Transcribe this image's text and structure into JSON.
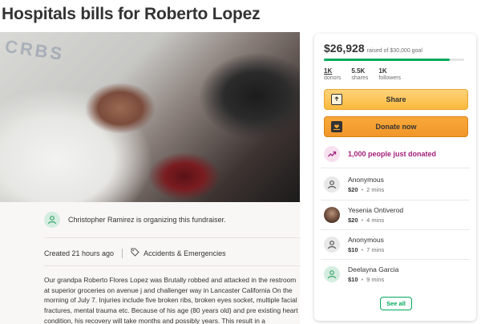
{
  "campaign": {
    "title": "Hospitals bills for Roberto Lopez",
    "photo_text": "CRBS"
  },
  "organizer": {
    "text": "Christopher Ramirez is organizing this fundraiser."
  },
  "meta": {
    "created": "Created 21 hours ago",
    "category": "Accidents & Emergencies"
  },
  "story": "Our grandpa Roberto Flores Lopez was Brutally robbed and attacked in the restroom at superior groceries on avenue j and challenger way in Lancaster California On the morning of July 7. Injuries include five broken ribs, broken eyes socket, multiple facial fractures, mental trauma etc. Because of his age (80 years old) and pre existing heart condition, his recovery will take months and possibly years. This result in a",
  "sidebar": {
    "raised": "$26,928",
    "goal_text": "raised of $30,000 goal",
    "progress_fraction": 0.8976,
    "stats": [
      {
        "value": "1K",
        "label": "donors"
      },
      {
        "value": "5.5K",
        "label": "shares"
      },
      {
        "value": "1K",
        "label": "followers"
      }
    ],
    "share_label": "Share",
    "donate_label": "Donate now",
    "trending_text": "1,000 people just donated",
    "donations": [
      {
        "name": "Anonymous",
        "amount": "$20",
        "time": "2 mins"
      },
      {
        "name": "Yesenia Ontiverod",
        "amount": "$20",
        "time": "4 mins"
      },
      {
        "name": "Anonymous",
        "amount": "$10",
        "time": "7 mins"
      },
      {
        "name": "Deelayna Garcia",
        "amount": "$10",
        "time": "9 mins"
      }
    ],
    "see_all_label": "See all"
  },
  "colors": {
    "brand_green": "#02a95c",
    "share_yellow": "#fbb93e",
    "donate_orange": "#f1962a",
    "trending_purple": "#a21f7a"
  },
  "icons": {
    "organizer": "user-icon",
    "category": "tag-icon",
    "share": "share-icon",
    "donate": "heart-hand-icon",
    "trending": "trending-up-icon",
    "donor": "user-icon"
  }
}
